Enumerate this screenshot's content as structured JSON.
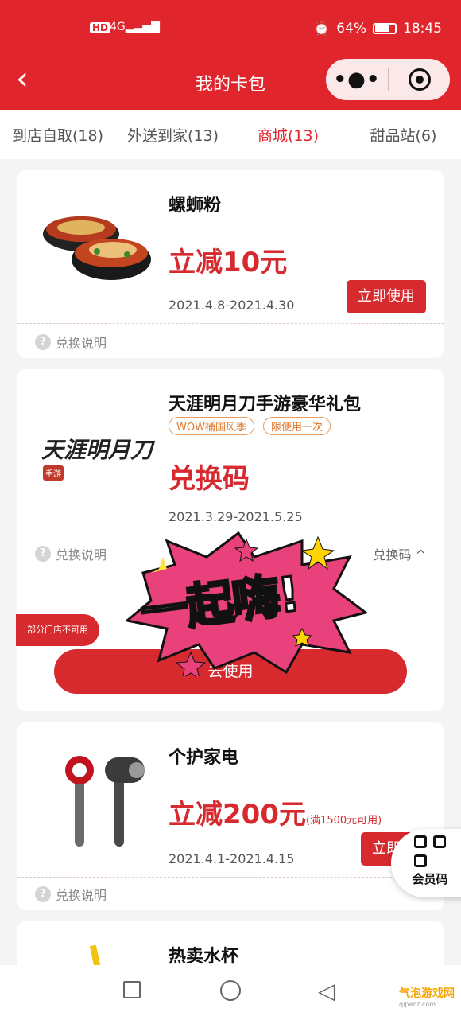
{
  "status_bar": {
    "network": "4G",
    "battery": "64%",
    "time": "18:45"
  },
  "header": {
    "title": "我的卡包",
    "menu_icon": "more-dots-icon",
    "target_icon": "target-icon"
  },
  "tabs": [
    {
      "label": "到店自取(18)"
    },
    {
      "label": "外送到家(13)"
    },
    {
      "label": "商城(13)",
      "active": true
    },
    {
      "label": "甜品站(6)"
    }
  ],
  "cards": [
    {
      "name": "螺蛳粉",
      "benefit": "立减10元",
      "date": "2021.4.8-2021.4.30",
      "button": "立即使用",
      "help": "兑换说明"
    },
    {
      "name": "天涯明月刀手游豪华礼包",
      "tags": [
        "WOW桶国风季",
        "限使用一次"
      ],
      "benefit": "兑换码",
      "date": "2021.3.29-2021.5.25",
      "help": "兑换说明",
      "code_toggle": "兑换码 ^",
      "badge": "部分门店不可用",
      "button": "去使用",
      "logo_text": "天涯明月刀",
      "logo_sub": "手游"
    },
    {
      "name": "个护家电",
      "benefit": "立减200元",
      "condition": "(满1500元可用)",
      "date": "2021.4.1-2021.4.15",
      "button": "立即使",
      "help": "兑换说明"
    },
    {
      "name": "热卖水杯"
    }
  ],
  "member_code": {
    "label": "会员码"
  },
  "sticker": {
    "text": "一起嗨!"
  },
  "watermark": {
    "text": "气泡游戏网",
    "sub": "qipaoz.com"
  },
  "colors": {
    "primary": "#e0262c",
    "tag": "#e07a2e"
  }
}
